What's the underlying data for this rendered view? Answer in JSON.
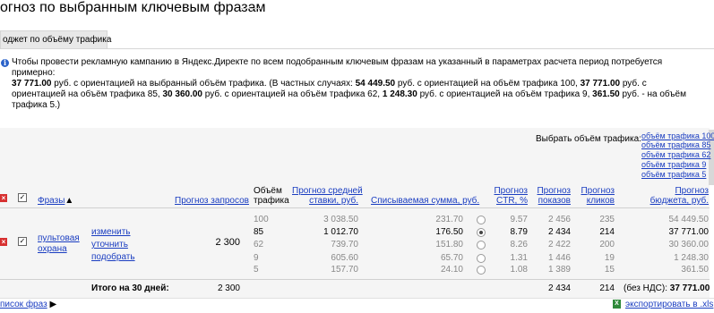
{
  "title": "огноз по выбранным ключевым фразам",
  "tab_label": "оджет по объёму трафика",
  "info": {
    "p1": "Чтобы провести рекламную кампанию в Яндекс.Директе по всем подобранным ключевым фразам на указанный в параметрах расчета период потребуется примерно:",
    "b1": "37 771.00",
    "t1": " руб. с ориентацией на выбранный объём трафика. (В частных случаях: ",
    "b2": "54 449.50",
    "t2": " руб. с ориентацией на объём трафика 100, ",
    "b3": "37 771.00",
    "t3": " руб. с ориентацией на объём трафика 85, ",
    "b4": "30 360.00",
    "t4": " руб. с ориентацией на объём трафика 62, ",
    "b5": "1 248.30",
    "t5": " руб. с ориентацией на объём трафика 9, ",
    "b6": "361.50",
    "t6": " руб. - на объём трафика 5.)"
  },
  "choose_volume_label": "Выбрать объём трафика:",
  "volume_links": [
    "объём трафика 100",
    "объём трафика 85",
    "объём трафика 62",
    "объём трафика 9",
    "объём трафика 5"
  ],
  "headers": {
    "phrases": "Фразы",
    "sort_arrow": "▲",
    "forecast_queries": "Прогноз запросов",
    "volume_1": "Объём",
    "volume_2": "трафика",
    "avg_bid_1": "Прогноз средней",
    "avg_bid_2": "ставки, руб.",
    "charged": "Списываемая сумма, руб.",
    "ctr_1": "Прогноз",
    "ctr_2": "CTR, %",
    "impressions_1": "Прогноз",
    "impressions_2": "показов",
    "clicks_1": "Прогноз",
    "clicks_2": "кликов",
    "budget_1": "Прогноз",
    "budget_2": "бюджета, руб."
  },
  "phrase": {
    "text_1": "пультовая",
    "text_2": "охрана",
    "action_edit": "изменить",
    "action_refine": "уточнить",
    "action_pick": "подобрать",
    "queries": "2 300"
  },
  "rows": [
    {
      "volume": "100",
      "bid": "3 038.50",
      "charged": "231.70",
      "ctr": "9.57",
      "impressions": "2 456",
      "clicks": "235",
      "budget": "54 449.50",
      "selected": false
    },
    {
      "volume": "85",
      "bid": "1 012.70",
      "charged": "176.50",
      "ctr": "8.79",
      "impressions": "2 434",
      "clicks": "214",
      "budget": "37 771.00",
      "selected": true
    },
    {
      "volume": "62",
      "bid": "739.70",
      "charged": "151.80",
      "ctr": "8.26",
      "impressions": "2 422",
      "clicks": "200",
      "budget": "30 360.00",
      "selected": false
    },
    {
      "volume": "9",
      "bid": "605.60",
      "charged": "65.70",
      "ctr": "1.31",
      "impressions": "1 446",
      "clicks": "19",
      "budget": "1 248.30",
      "selected": false
    },
    {
      "volume": "5",
      "bid": "157.70",
      "charged": "24.10",
      "ctr": "1.08",
      "impressions": "1 389",
      "clicks": "15",
      "budget": "361.50",
      "selected": false
    }
  ],
  "totals": {
    "label": "Итого на 30 дней:",
    "queries": "2 300",
    "impressions": "2 434",
    "clicks": "214",
    "budget_prefix": "(без НДС):",
    "budget": "37 771.00"
  },
  "footer": {
    "phrases_list": "писок фраз",
    "arrow": "▶",
    "export": "экспортировать в .xls"
  }
}
